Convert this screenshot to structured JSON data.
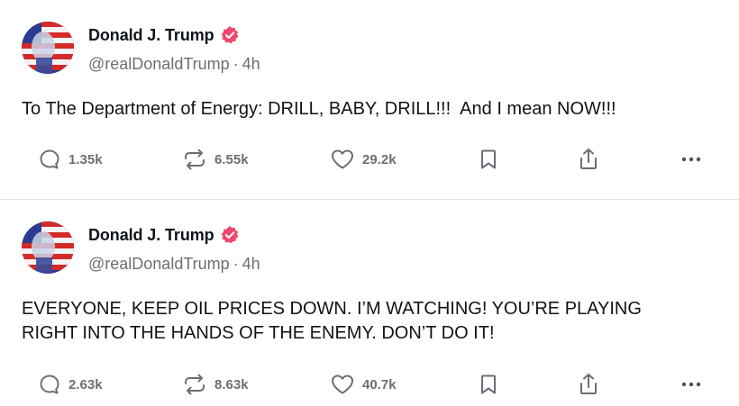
{
  "posts": [
    {
      "author_name": "Donald J. Trump",
      "handle": "@realDonaldTrump",
      "separator": "·",
      "time": "4h",
      "text": "To The Department of Energy: DRILL, BABY, DRILL!!!  And I mean NOW!!!",
      "replies": "1.35k",
      "retruths": "6.55k",
      "likes": "29.2k"
    },
    {
      "author_name": "Donald J. Trump",
      "handle": "@realDonaldTrump",
      "separator": "·",
      "time": "4h",
      "text": "EVERYONE, KEEP OIL PRICES DOWN. I’M WATCHING! YOU’RE PLAYING\nRIGHT INTO THE HANDS OF THE ENEMY. DON’T DO IT!",
      "replies": "2.63k",
      "retruths": "8.63k",
      "likes": "40.7k"
    }
  ],
  "colors": {
    "verified": "#f0466b",
    "muted": "#6b6f75",
    "divider": "#e6e6e6"
  },
  "icons": [
    "avatar",
    "verified-badge-icon",
    "reply-icon",
    "retruth-icon",
    "like-icon",
    "bookmark-icon",
    "share-icon",
    "more-icon"
  ]
}
